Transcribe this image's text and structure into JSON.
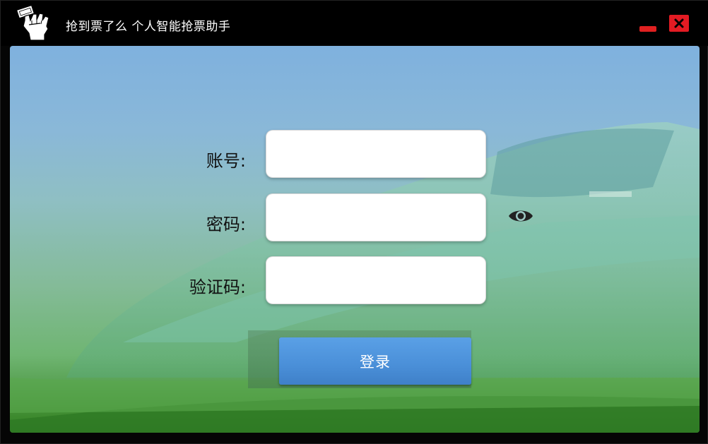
{
  "window": {
    "title": "抢到票了么  个人智能抢票助手",
    "logo_icon": "raised-fist-ticket-icon"
  },
  "controls": {
    "minimize_icon": "minimize-icon",
    "close_icon": "close-icon",
    "close_color": "#e31b23"
  },
  "form": {
    "account_label": "账号:",
    "password_label": "密码:",
    "captcha_label": "验证码:",
    "account_value": "",
    "password_value": "",
    "captcha_value": "",
    "toggle_password_icon": "eye-icon",
    "login_label": "登录",
    "login_color": "#4a8fd8"
  }
}
